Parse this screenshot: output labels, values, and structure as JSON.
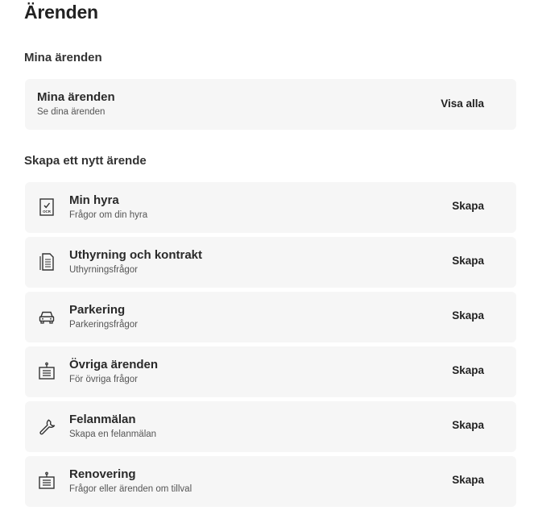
{
  "page": {
    "title": "Ärenden"
  },
  "my_cases": {
    "heading": "Mina ärenden",
    "card": {
      "title": "Mina ärenden",
      "subtitle": "Se dina ärenden",
      "action": "Visa alla"
    }
  },
  "create": {
    "heading": "Skapa ett nytt ärende",
    "items": [
      {
        "icon": "rent-document-icon",
        "title": "Min hyra",
        "subtitle": "Frågor om din hyra",
        "action": "Skapa",
        "icon_text": "OCR"
      },
      {
        "icon": "contract-document-icon",
        "title": "Uthyrning och kontrakt",
        "subtitle": "Uthyrningsfrågor",
        "action": "Skapa"
      },
      {
        "icon": "car-icon",
        "title": "Parkering",
        "subtitle": "Parkeringsfrågor",
        "action": "Skapa"
      },
      {
        "icon": "clipboard-icon",
        "title": "Övriga ärenden",
        "subtitle": "För övriga frågor",
        "action": "Skapa"
      },
      {
        "icon": "wrench-icon",
        "title": "Felanmälan",
        "subtitle": "Skapa en felanmälan",
        "action": "Skapa"
      },
      {
        "icon": "clipboard-icon",
        "title": "Renovering",
        "subtitle": "Frågor eller ärenden om tillval",
        "action": "Skapa"
      }
    ]
  }
}
